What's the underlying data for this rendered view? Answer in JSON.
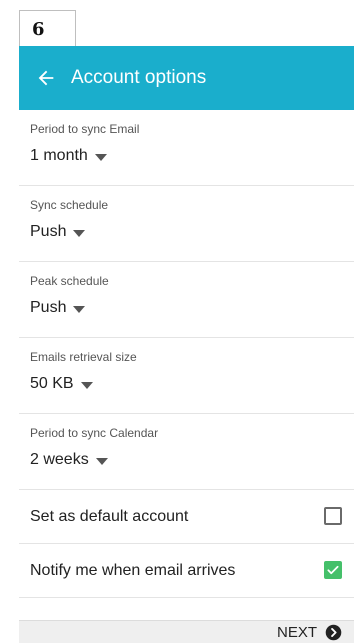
{
  "step": {
    "number": "6"
  },
  "appbar": {
    "back_icon": "arrow-left-icon",
    "title": "Account options",
    "color": "#1aaecc"
  },
  "settings": [
    {
      "label": "Period to sync Email",
      "value": "1 month"
    },
    {
      "label": "Sync schedule",
      "value": "Push"
    },
    {
      "label": "Peak schedule",
      "value": "Push"
    },
    {
      "label": "Emails retrieval size",
      "value": "50 KB"
    },
    {
      "label": "Period to sync Calendar",
      "value": "2 weeks"
    }
  ],
  "checkboxes": [
    {
      "label": "Set as default account",
      "checked": false
    },
    {
      "label": "Notify me when email arrives",
      "checked": true,
      "color": "#45c06a"
    }
  ],
  "footer": {
    "next_label": "NEXT",
    "next_icon": "chevron-right-circle-icon"
  }
}
